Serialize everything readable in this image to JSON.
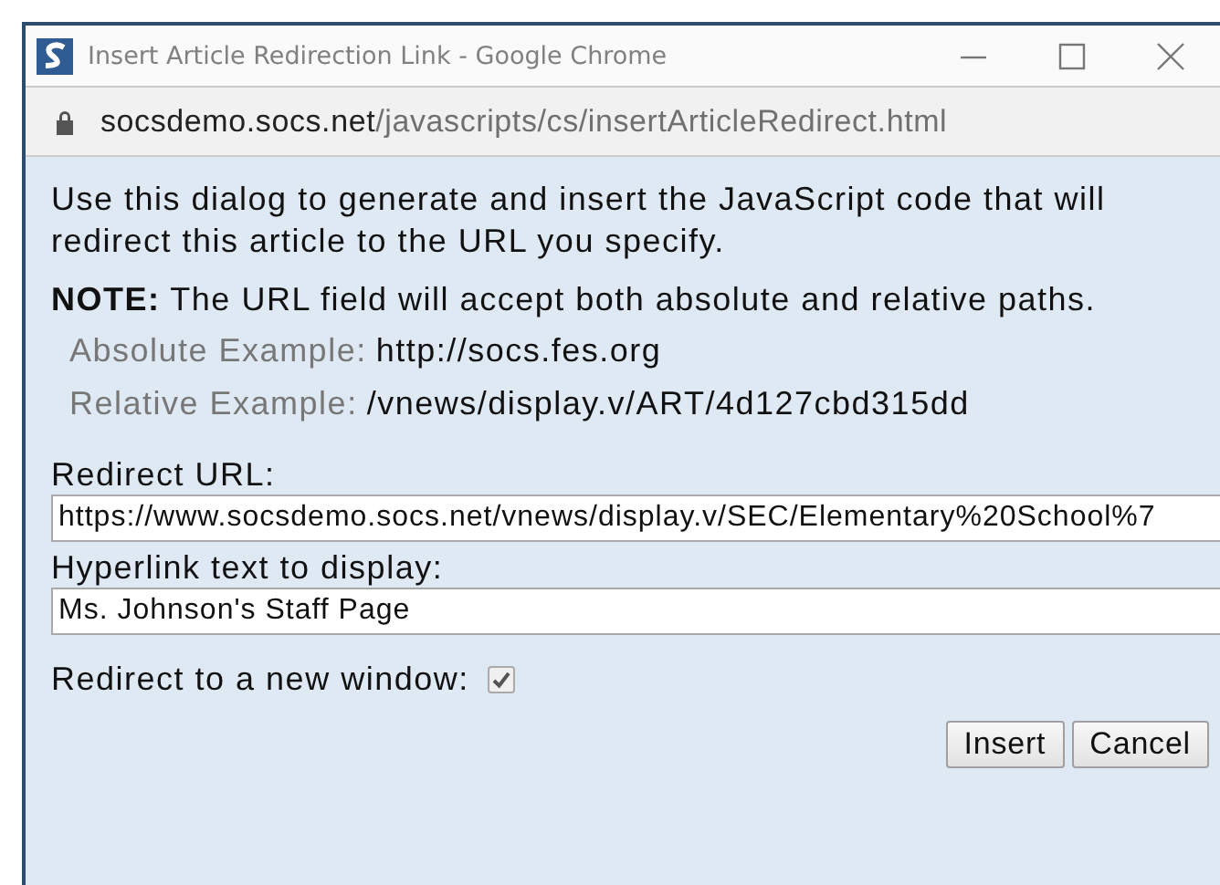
{
  "window": {
    "title": "Insert Article Redirection Link - Google Chrome"
  },
  "address_bar": {
    "domain": "socsdemo.socs.net",
    "path": "/javascripts/cs/insertArticleRedirect.html"
  },
  "intro": "Use this dialog to generate and insert the JavaScript code that will redirect this article to the URL you specify.",
  "note": "**NOTE:** The URL field will accept both absolute and relative paths.",
  "examples": [
    {
      "label": "Absolute Example:",
      "value": "http://socs.fes.org"
    },
    {
      "label": "Relative Example:",
      "value": "/vnews/display.v/ART/4d127cbd315dd"
    }
  ],
  "fields": [
    {
      "label": "Redirect URL:",
      "value": "https://www.socsdemo.socs.net/vnews/display.v/SEC/Elementary%20School%7"
    },
    {
      "label": "Hyperlink text to display:",
      "value": "Ms. Johnson's Staff Page"
    }
  ],
  "new_window": {
    "label": "Redirect to a new window:",
    "checked": true
  },
  "buttons": [
    "Insert",
    "Cancel"
  ]
}
